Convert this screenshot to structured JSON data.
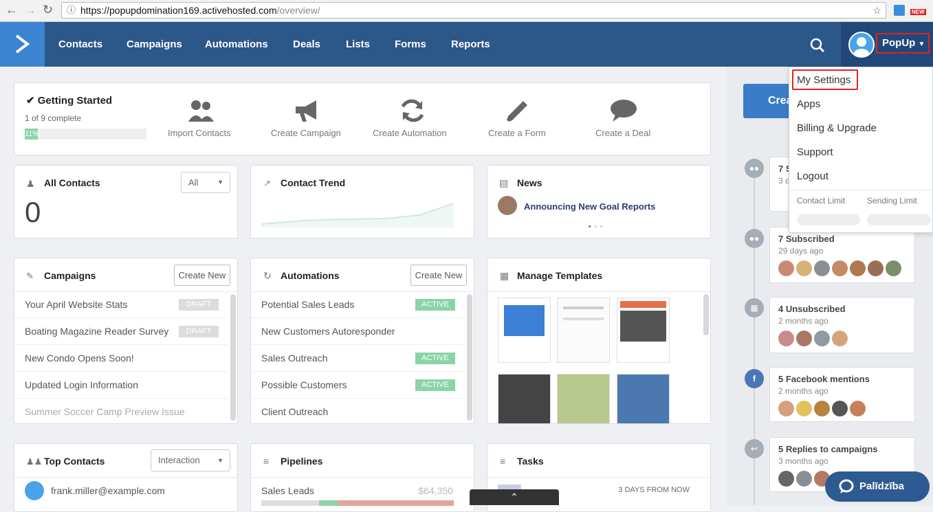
{
  "browser": {
    "url_host": "https://popupdomination169.activehosted.com",
    "url_path": "/overview/",
    "ext_badge": "NEW"
  },
  "nav": {
    "items": [
      "Contacts",
      "Campaigns",
      "Automations",
      "Deals",
      "Lists",
      "Forms",
      "Reports"
    ],
    "user_label": "PopUp"
  },
  "dropdown": {
    "items": [
      "My Settings",
      "Apps",
      "Billing & Upgrade",
      "Support",
      "Logout"
    ],
    "limit_contact": "Contact Limit",
    "limit_sending": "Sending Limit"
  },
  "getting_started": {
    "title": "Getting Started",
    "progress_text": "1 of 9 complete",
    "progress_pct": 11,
    "progress_label": "11%",
    "steps": [
      "Import Contacts",
      "Create Campaign",
      "Create Automation",
      "Create a Form",
      "Create a Deal"
    ]
  },
  "all_contacts": {
    "title": "All Contacts",
    "filter": "All",
    "count": "0"
  },
  "contact_trend": {
    "title": "Contact Trend"
  },
  "news": {
    "title": "News",
    "headline": "Announcing New Goal Reports"
  },
  "campaigns": {
    "title": "Campaigns",
    "create": "Create New",
    "rows": [
      {
        "name": "Your April Website Stats",
        "status": "DRAFT"
      },
      {
        "name": "Boating Magazine Reader Survey",
        "status": "DRAFT"
      },
      {
        "name": "New Condo Opens Soon!",
        "status": ""
      },
      {
        "name": "Updated Login Information",
        "status": ""
      },
      {
        "name": "Summer Soccer Camp Preview Issue",
        "status": ""
      }
    ]
  },
  "automations": {
    "title": "Automations",
    "create": "Create New",
    "rows": [
      {
        "name": "Potential Sales Leads",
        "status": "ACTIVE"
      },
      {
        "name": "New Customers Autoresponder",
        "status": ""
      },
      {
        "name": "Sales Outreach",
        "status": "ACTIVE"
      },
      {
        "name": "Possible Customers",
        "status": "ACTIVE"
      },
      {
        "name": "Client Outreach",
        "status": ""
      }
    ]
  },
  "templates": {
    "title": "Manage Templates"
  },
  "top_contacts": {
    "title": "Top Contacts",
    "filter": "Interaction",
    "first": "frank.miller@example.com"
  },
  "pipelines": {
    "title": "Pipelines",
    "first": "Sales Leads",
    "value": "$64,350"
  },
  "tasks": {
    "title": "Tasks",
    "first_due": "3 DAYS FROM NOW"
  },
  "create_btn": "Crea",
  "timeline": [
    {
      "title": "7 S",
      "sub": "3 d"
    },
    {
      "title": "7 Subscribed",
      "sub": "29 days ago"
    },
    {
      "title": "4 Unsubscribed",
      "sub": "2 months ago"
    },
    {
      "title": "5 Facebook mentions",
      "sub": "2 months ago"
    },
    {
      "title": "5 Replies to campaigns",
      "sub": "3 months ago"
    }
  ],
  "help": "Palīdzība",
  "colors": {
    "nav": "#2c5789",
    "accent": "#3b84d1",
    "active": "#8bd4a8",
    "highlight": "#e2221f"
  }
}
